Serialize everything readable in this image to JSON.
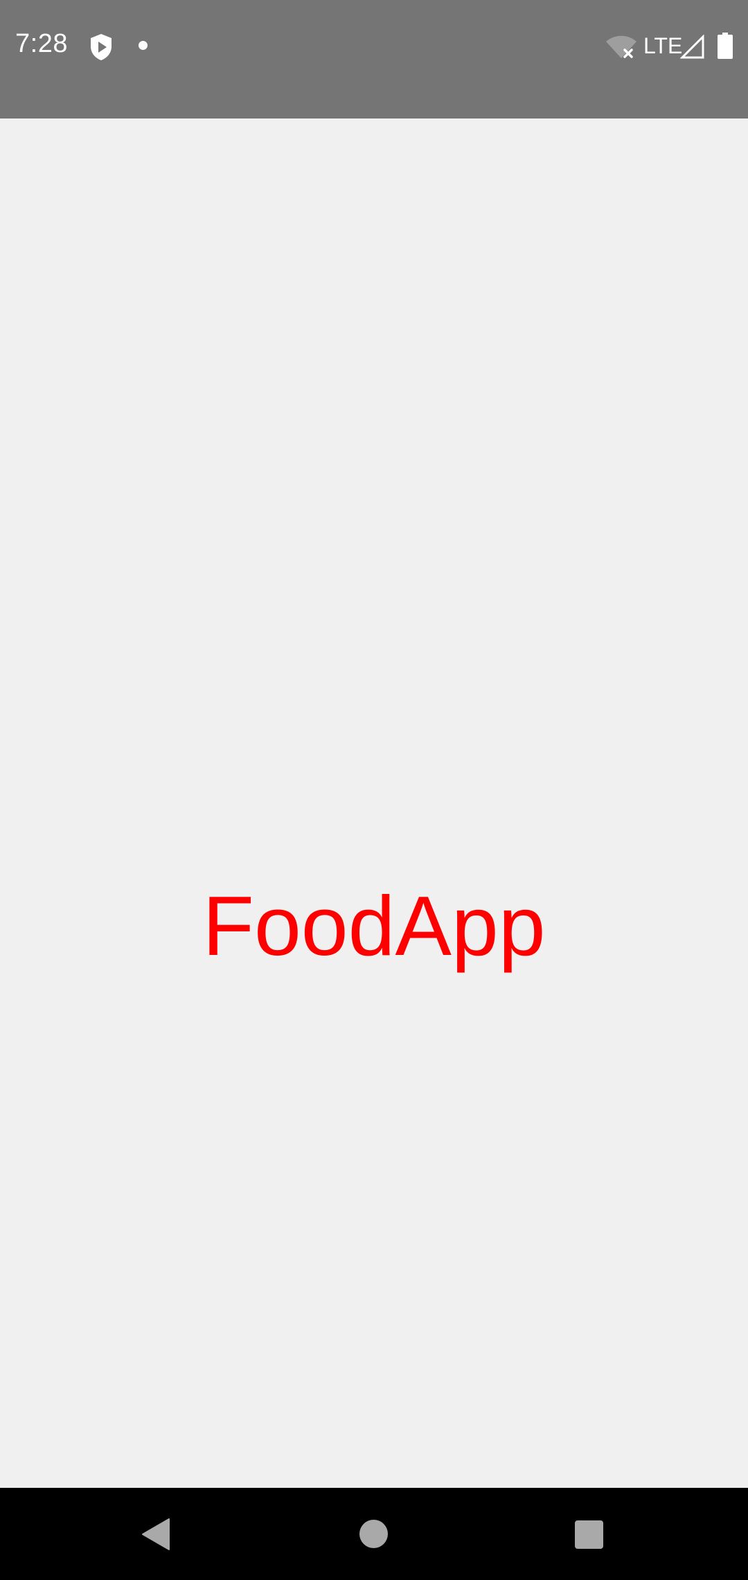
{
  "status_bar": {
    "time": "7:28",
    "network_label": "LTE",
    "icons": [
      "play-protect-shield-icon",
      "notification-dot-icon",
      "wifi-off-icon",
      "cell-signal-icon",
      "battery-icon"
    ],
    "background_color": "#757575"
  },
  "main": {
    "app_name": "FoodApp",
    "title_color": "#ff0000",
    "background_color": "#f1f0f1"
  },
  "nav_bar": {
    "icons": [
      "back-icon",
      "home-icon",
      "recents-icon"
    ],
    "background_color": "#000000"
  }
}
